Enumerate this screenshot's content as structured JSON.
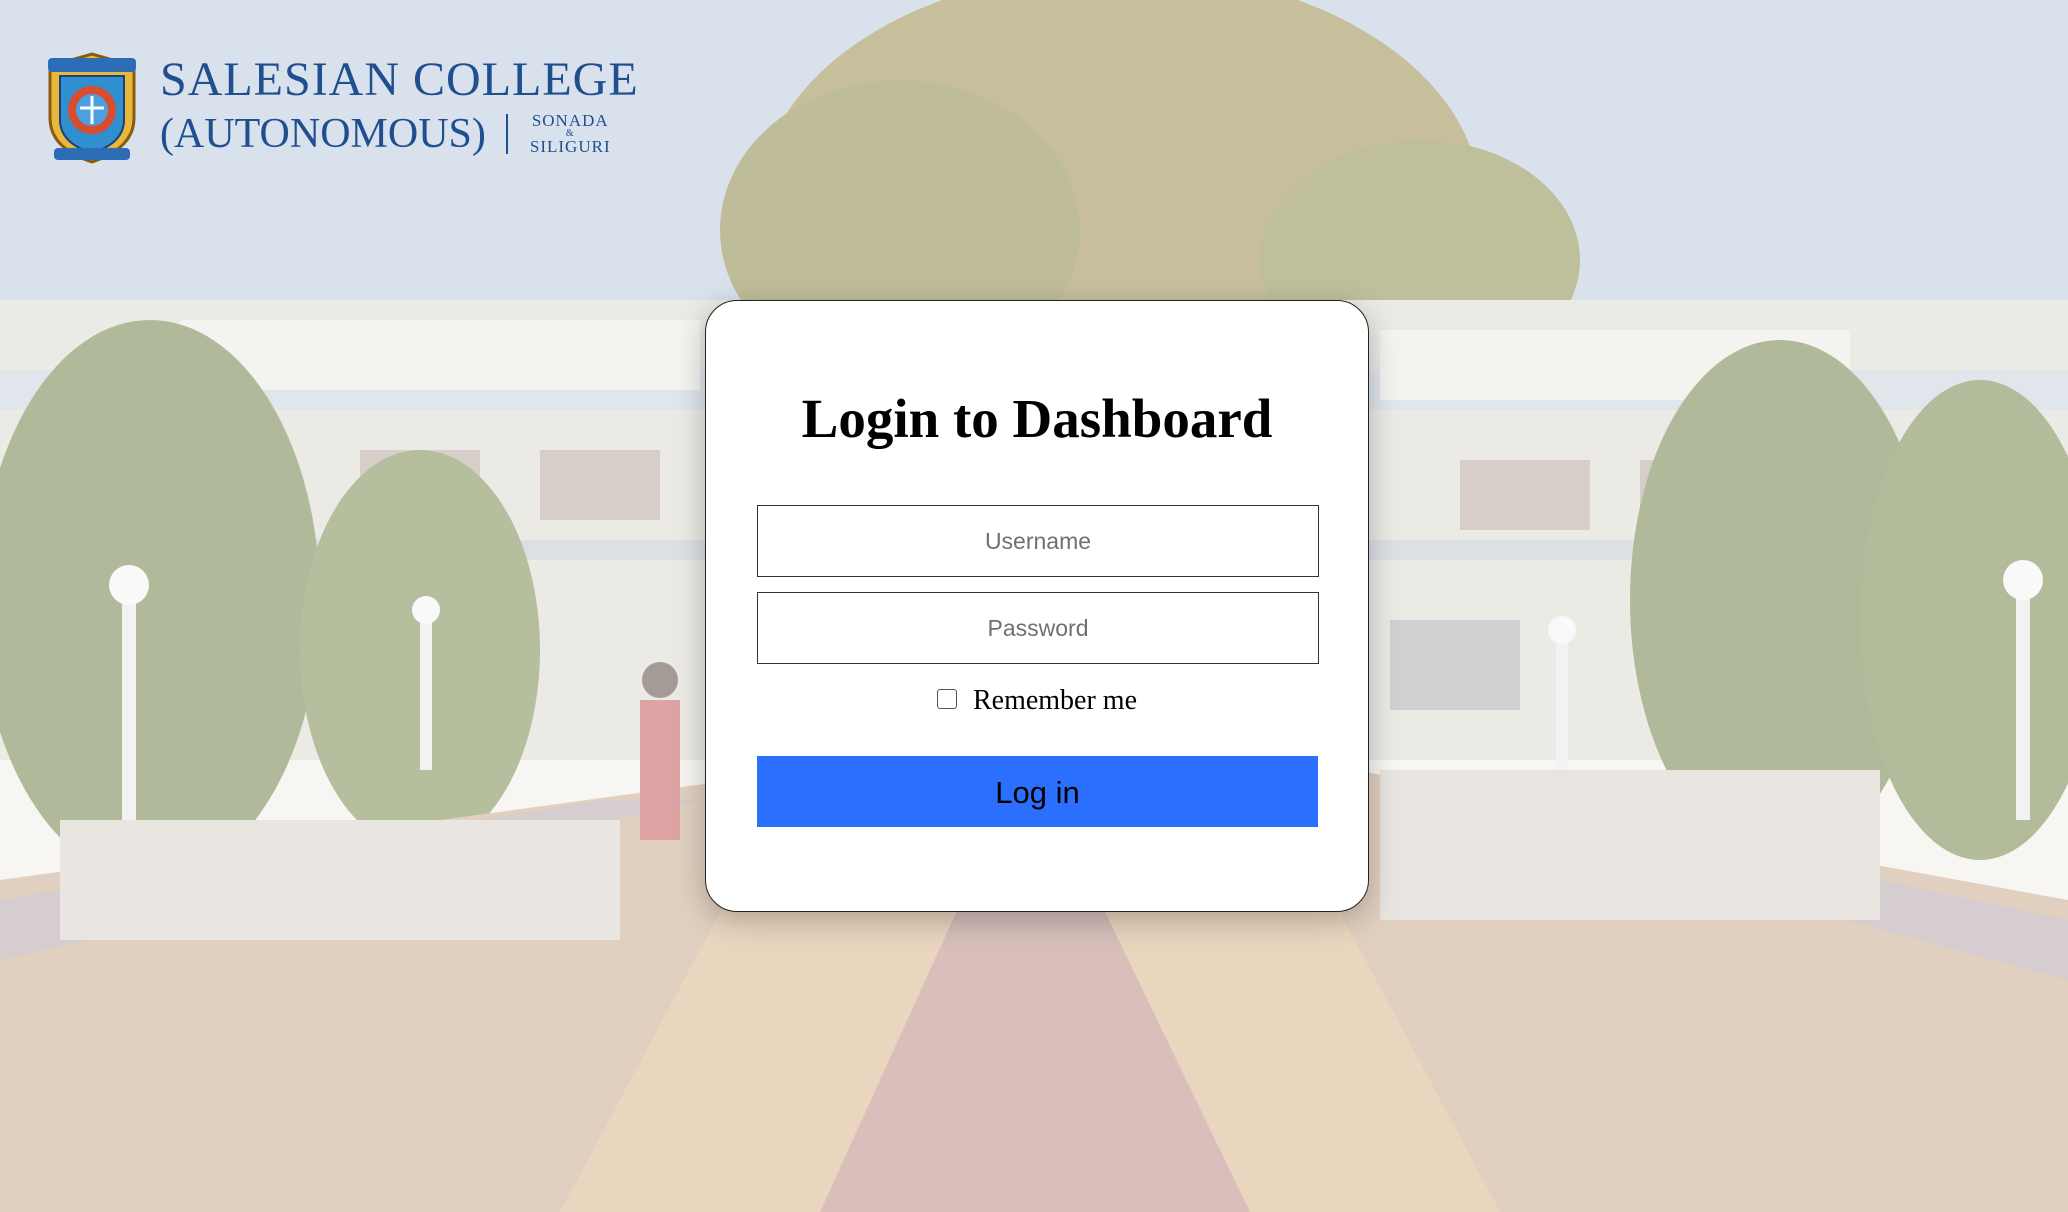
{
  "header": {
    "college_name_line1": "SALESIAN COLLEGE",
    "college_name_line2": "(AUTONOMOUS)",
    "campus_line1": "SONADA",
    "campus_amp": "&",
    "campus_line2": "SILIGURI",
    "crest_icon": "college-crest-icon"
  },
  "login": {
    "title": "Login to Dashboard",
    "username_placeholder": "Username",
    "password_placeholder": "Password",
    "remember_label": "Remember me",
    "remember_checked": false,
    "submit_label": "Log in"
  },
  "colors": {
    "brand_blue": "#1f4f8f",
    "button_blue": "#2b6fff"
  }
}
